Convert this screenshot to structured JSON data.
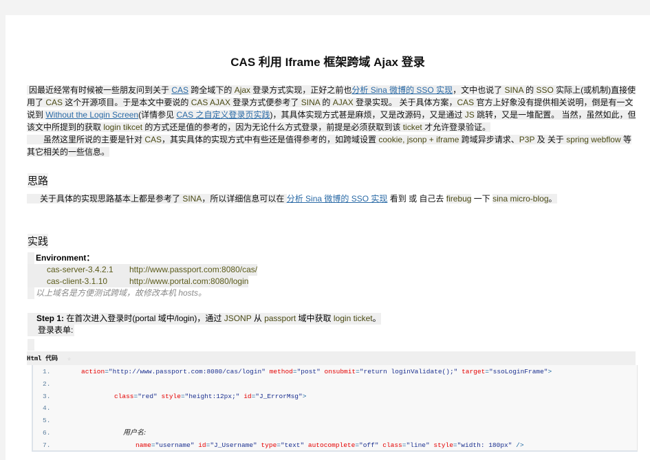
{
  "article": {
    "title": "CAS 利用 Iframe 框架跨域 Ajax 登录",
    "intro": {
      "p1_a": "因最近经常有时候被一些朋友问到关于 ",
      "p1_link1": "CAS",
      "p1_b": " 跨全域下的 ",
      "p1_en1": "Ajax",
      "p1_c": " 登录方式实现，正好之前也",
      "p1_link2": "分析 Sina 微博的 SSO 实现",
      "p1_d": "，文中也说了 ",
      "p1_en2": "SINA",
      "p1_e": " 的 ",
      "p1_en3": "SSO",
      "p1_f": " 实际上(或机制)直接使用了 ",
      "p1_en4": "CAS",
      "p1_g": " 这个开源项目。于是本文中要说的 ",
      "p1_en5": "CAS AJAX",
      "p1_h": " 登录方式便参考了 ",
      "p1_en6": "SINA",
      "p1_i": " 的 ",
      "p1_en7": "AJAX",
      "p1_j": " 登录实现。 关于具体方案，",
      "p1_en8": "CAS",
      "p1_k": " 官方上好象没有提供相关说明，倒是有一文说到 ",
      "p1_link3": "Without the Login Screen",
      "p1_l": "(详情参见 ",
      "p1_link4": "CAS 之自定义登录页实践",
      "p1_m": ")，其具体实现方式甚是麻烦，又是改源码，又是通过 ",
      "p1_en9": "JS",
      "p1_n": " 跳转，又是一堆配置。 当然，虽然如此，但该文中所提到的获取 ",
      "p1_en10": "login tikcet",
      "p1_o": " 的方式还是值的参考的，因为无论什么方式登录，前提是必须获取到该 ",
      "p1_en11": "ticket",
      "p1_p": " 才允许登录验证。",
      "p2_a": "虽然这里所说的主要是针对 ",
      "p2_en1": "CAS",
      "p2_b": "，其实具体的实现方式中有些还是值得参考的，如跨域设置 ",
      "p2_en2": "cookie, jsonp + iframe",
      "p2_c": " 跨域异步请求、",
      "p2_en3": "P3P",
      "p2_d": " 及 关于 ",
      "p2_en4": "spring webflow",
      "p2_e": " 等其它相关的一些信息。"
    },
    "section1": {
      "heading": "思路",
      "text_a": "关于具体的实现思路基本上都是参考了 ",
      "text_en1": "SINA",
      "text_b": "，所以详细信息可以在 ",
      "text_link": "分析 Sina 微博的 SSO 实现",
      "text_c": " 看到 或 自己去 ",
      "text_en2": "firebug",
      "text_d": " 一下 ",
      "text_en3": "sina micro-blog",
      "text_e": "。"
    },
    "section2": {
      "heading": "实践",
      "env_label": "Environment：",
      "env": [
        {
          "name": "cas-server-3.4.2.1",
          "url": "http://www.passport.com:8080/cas/"
        },
        {
          "name": "cas-client-3.1.10",
          "url": "http://www.portal.com:8080/login"
        }
      ],
      "note": "以上域名是方便测试跨域，故修改本机 hosts。",
      "step_label": "Step 1:",
      "step_a": " 在首次进入登录时(portal 域中/login)，通过 ",
      "step_en1": "JSONP",
      "step_b": " 从 ",
      "step_en2": "passport",
      "step_c": " 域中获取 ",
      "step_en3": "login ticket",
      "step_d": "。",
      "form_label": "登录表单:"
    },
    "code": {
      "header": "Html 代码",
      "copy_icon": "☆",
      "lines": [
        {
          "n": "1.",
          "parts": [
            {
              "t": "action",
              "c": "attr"
            },
            {
              "t": "=",
              "c": "tag"
            },
            {
              "t": "\"http://www.passport.com:8080/cas/login\"",
              "c": "val"
            },
            {
              "t": " ",
              "c": "val"
            },
            {
              "t": "method",
              "c": "attr"
            },
            {
              "t": "=",
              "c": "tag"
            },
            {
              "t": "\"post\"",
              "c": "val"
            },
            {
              "t": " ",
              "c": "val"
            },
            {
              "t": "onsubmit",
              "c": "attr"
            },
            {
              "t": "=",
              "c": "tag"
            },
            {
              "t": "\"return loginValidate();\"",
              "c": "val"
            },
            {
              "t": " ",
              "c": "val"
            },
            {
              "t": "target",
              "c": "attr"
            },
            {
              "t": "=",
              "c": "tag"
            },
            {
              "t": "\"ssoLoginFrame\"",
              "c": "val"
            },
            {
              "t": ">",
              "c": "tag"
            }
          ]
        },
        {
          "n": "2.",
          "parts": []
        },
        {
          "n": "3.",
          "parts": [
            {
              "t": "class",
              "c": "attr"
            },
            {
              "t": "=",
              "c": "tag"
            },
            {
              "t": "\"red\"",
              "c": "val"
            },
            {
              "t": " ",
              "c": "val"
            },
            {
              "t": "style",
              "c": "attr"
            },
            {
              "t": "=",
              "c": "tag"
            },
            {
              "t": "\"height:12px;\"",
              "c": "val"
            },
            {
              "t": " ",
              "c": "val"
            },
            {
              "t": "id",
              "c": "attr"
            },
            {
              "t": "=",
              "c": "tag"
            },
            {
              "t": "\"J_ErrorMsg\"",
              "c": "val"
            },
            {
              "t": ">",
              "c": "tag"
            }
          ]
        },
        {
          "n": "4.",
          "parts": []
        },
        {
          "n": "5.",
          "parts": []
        },
        {
          "n": "6.",
          "parts": [
            {
              "t": "用户名:",
              "c": "cn"
            }
          ]
        },
        {
          "n": "7.",
          "parts": [
            {
              "t": "name",
              "c": "attr"
            },
            {
              "t": "=",
              "c": "tag"
            },
            {
              "t": "\"username\"",
              "c": "val"
            },
            {
              "t": " ",
              "c": "val"
            },
            {
              "t": "id",
              "c": "attr"
            },
            {
              "t": "=",
              "c": "tag"
            },
            {
              "t": "\"J_Username\"",
              "c": "val"
            },
            {
              "t": " ",
              "c": "val"
            },
            {
              "t": "type",
              "c": "attr"
            },
            {
              "t": "=",
              "c": "tag"
            },
            {
              "t": "\"text\"",
              "c": "val"
            },
            {
              "t": " ",
              "c": "val"
            },
            {
              "t": "autocomplete",
              "c": "attr"
            },
            {
              "t": "=",
              "c": "tag"
            },
            {
              "t": "\"off\"",
              "c": "val"
            },
            {
              "t": " ",
              "c": "val"
            },
            {
              "t": "class",
              "c": "attr"
            },
            {
              "t": "=",
              "c": "tag"
            },
            {
              "t": "\"line\"",
              "c": "val"
            },
            {
              "t": " ",
              "c": "val"
            },
            {
              "t": "style",
              "c": "attr"
            },
            {
              "t": "=",
              "c": "tag"
            },
            {
              "t": "\"width: 180px\"",
              "c": "val"
            },
            {
              "t": " />",
              "c": "tag"
            }
          ]
        }
      ]
    }
  }
}
